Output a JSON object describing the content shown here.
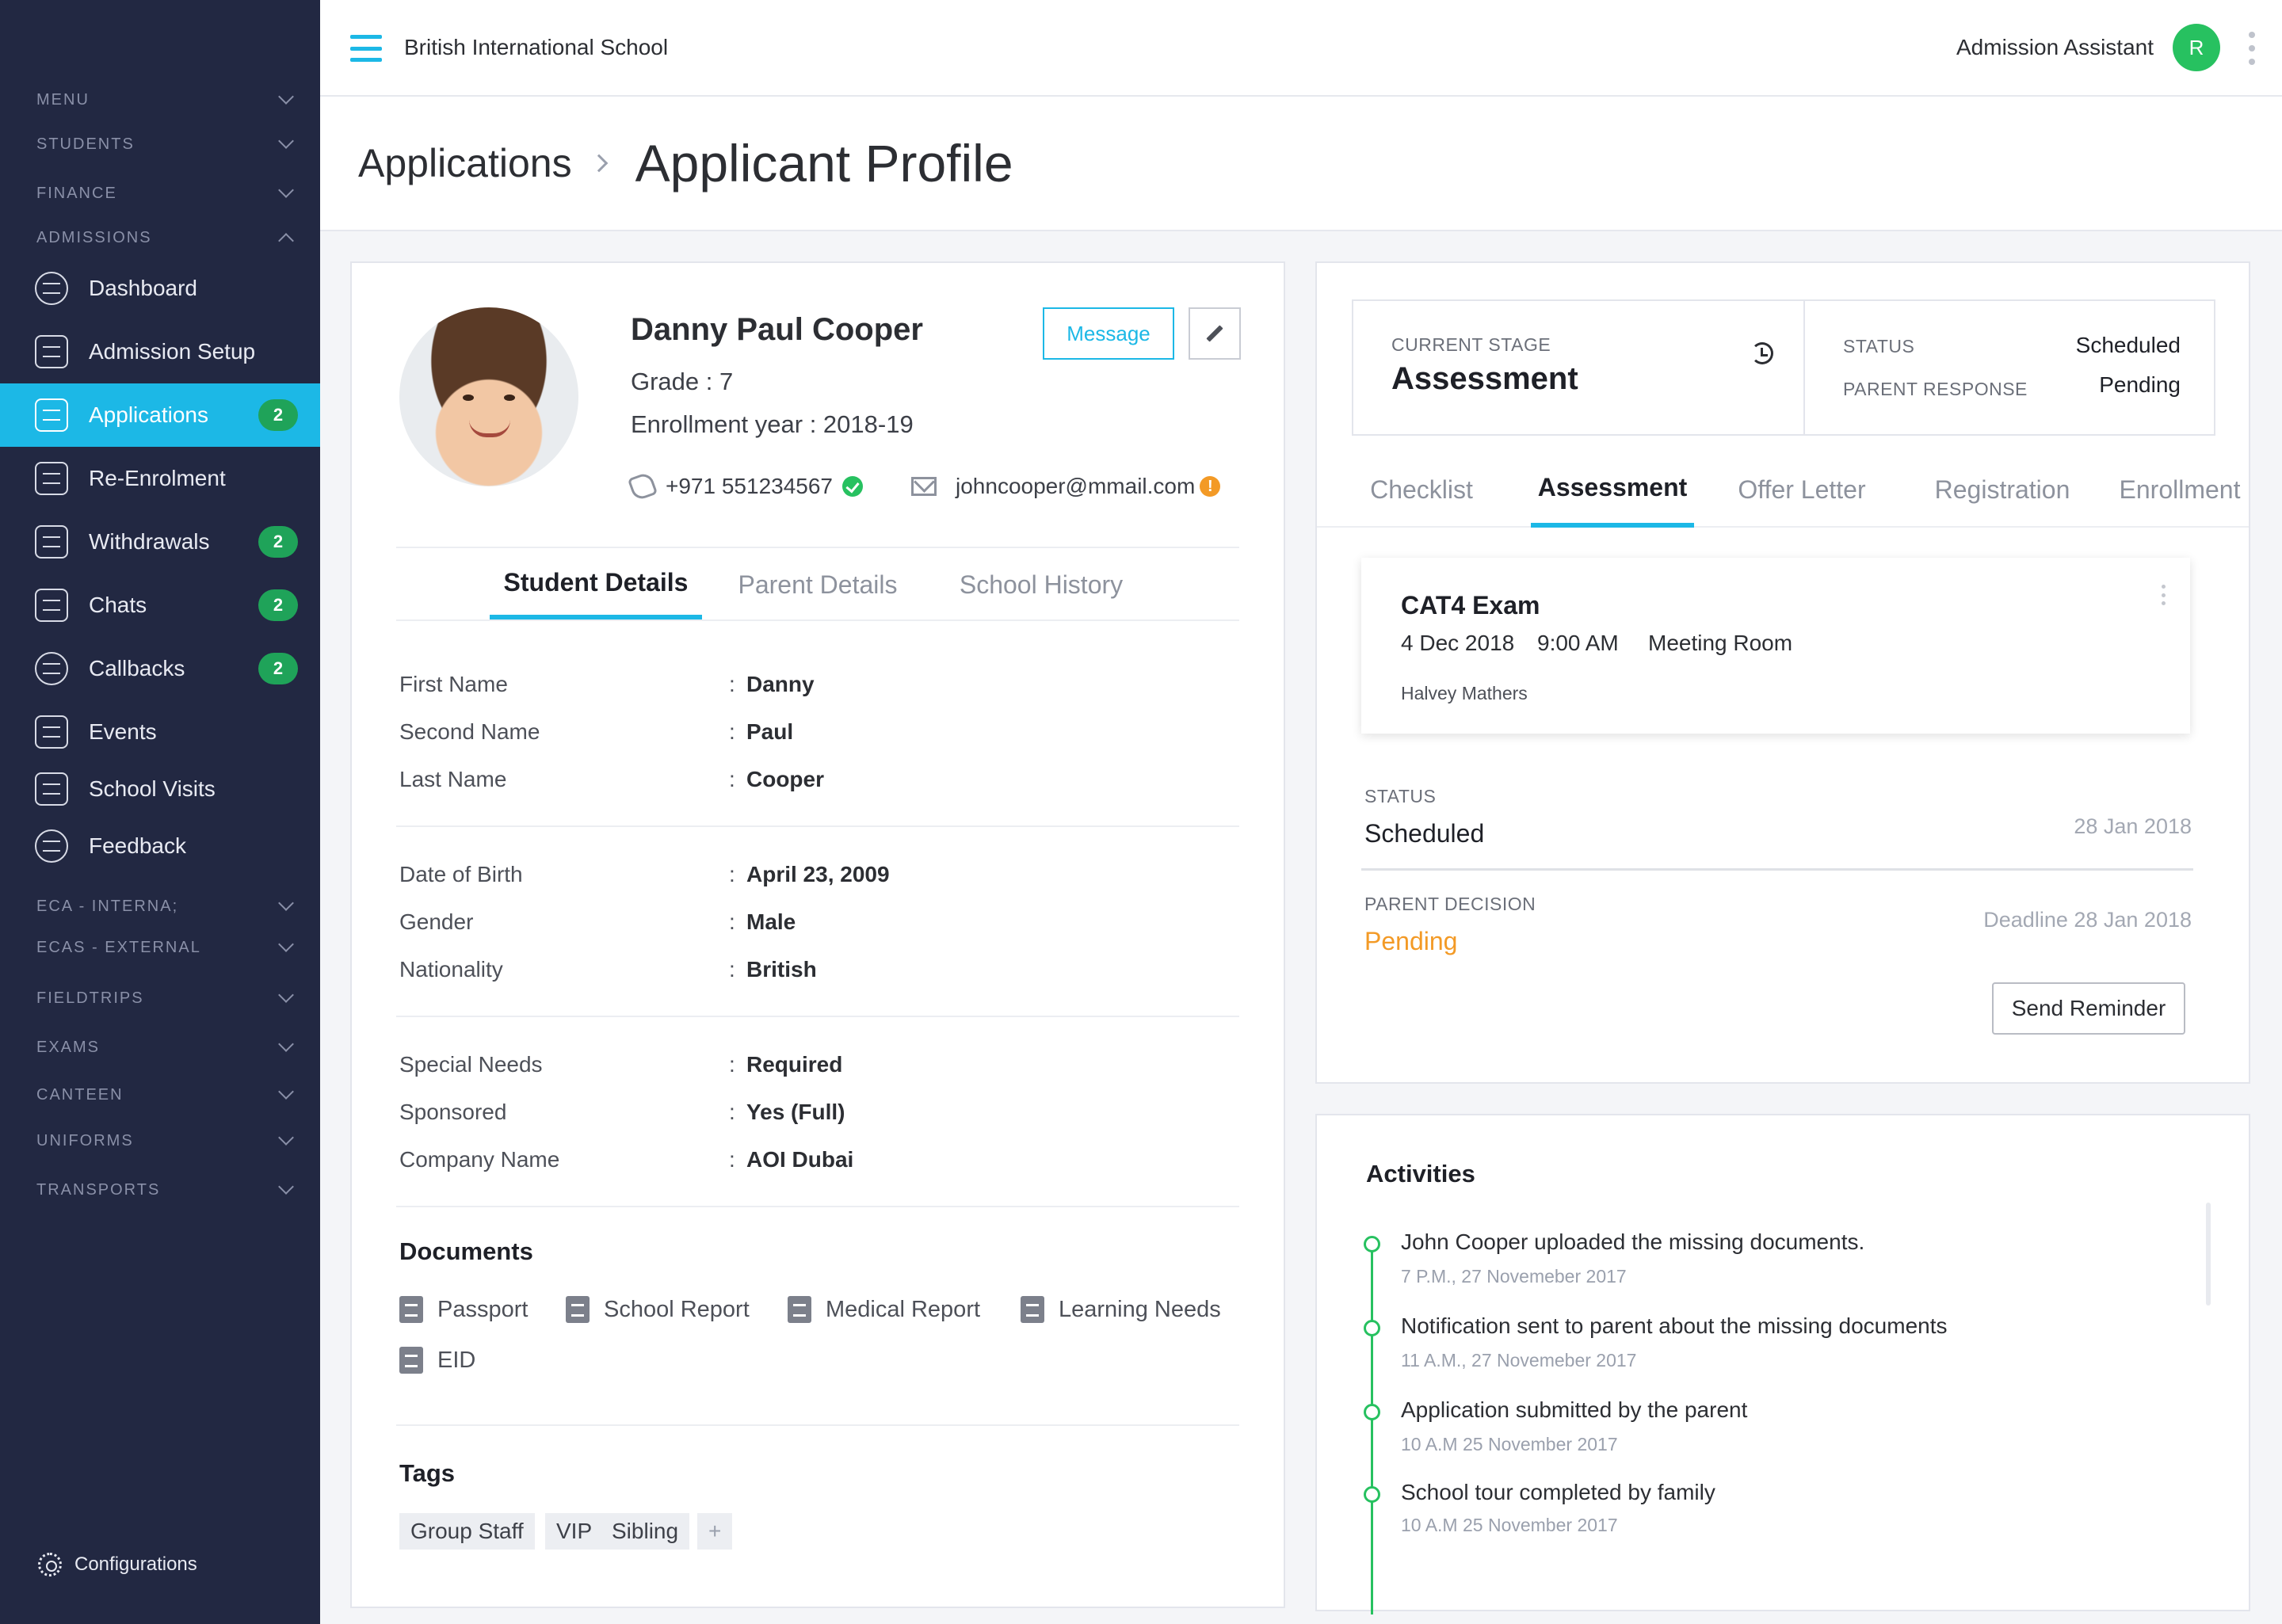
{
  "topbar": {
    "school_name": "British International School",
    "user_role": "Admission Assistant",
    "avatar_initial": "R"
  },
  "sidebar": {
    "sections": {
      "menu": "MENU",
      "students": "STUDENTS",
      "finance": "FINANCE",
      "admissions": "ADMISSIONS",
      "eca_internal": "ECA - INTERNA;",
      "ecas_external": "ECAS - EXTERNAL",
      "fieldtrips": "FIELDTRIPS",
      "exams": "EXAMS",
      "canteen": "CANTEEN",
      "uniforms": "UNIFORMS",
      "transports": "TRANSPORTS"
    },
    "items": [
      {
        "label": "Dashboard",
        "icon": "dashboard-icon"
      },
      {
        "label": "Admission Setup",
        "icon": "admission-setup-icon"
      },
      {
        "label": "Applications",
        "icon": "applications-icon",
        "badge": "2",
        "active": true
      },
      {
        "label": "Re-Enrolment",
        "icon": "re-enrolment-icon"
      },
      {
        "label": "Withdrawals",
        "icon": "withdrawals-icon",
        "badge": "2"
      },
      {
        "label": "Chats",
        "icon": "chats-icon",
        "badge": "2"
      },
      {
        "label": "Callbacks",
        "icon": "callbacks-icon",
        "badge": "2"
      },
      {
        "label": "Events",
        "icon": "events-icon"
      },
      {
        "label": "School Visits",
        "icon": "school-visits-icon"
      },
      {
        "label": "Feedback",
        "icon": "feedback-icon"
      }
    ],
    "configurations": "Configurations"
  },
  "header": {
    "breadcrumb": "Applications",
    "title": "Applicant Profile"
  },
  "profile": {
    "name": "Danny Paul Cooper",
    "grade": "Grade : 7",
    "enrollment_year": "Enrollment year : 2018-19",
    "phone": "+971 551234567",
    "email": "johncooper@mmail.com",
    "message_button": "Message",
    "tabs": [
      "Student Details",
      "Parent Details",
      "School History"
    ],
    "fields": [
      {
        "label": "First Name",
        "value": "Danny"
      },
      {
        "label": "Second Name",
        "value": "Paul"
      },
      {
        "label": "Last Name",
        "value": "Cooper"
      },
      {
        "label": "Date of Birth",
        "value": "April 23, 2009"
      },
      {
        "label": "Gender",
        "value": "Male"
      },
      {
        "label": "Nationality",
        "value": "British"
      },
      {
        "label": "Special Needs",
        "value": "Required"
      },
      {
        "label": "Sponsored",
        "value": "Yes (Full)"
      },
      {
        "label": "Company Name",
        "value": "AOI Dubai"
      }
    ],
    "colon": ":",
    "documents_title": "Documents",
    "documents": [
      "Passport",
      "School Report",
      "Medical Report",
      "Learning Needs",
      "EID"
    ],
    "tags_title": "Tags",
    "tags": [
      "Group Staff",
      "VIP",
      "Sibling"
    ],
    "add_tag": "+"
  },
  "stage": {
    "current_stage_label": "CURRENT STAGE",
    "current_stage": "Assessment",
    "status_label": "STATUS",
    "status": "Scheduled",
    "parent_response_label": "PARENT RESPONSE",
    "parent_response": "Pending",
    "tabs": [
      "Checklist",
      "Assessment",
      "Offer Letter",
      "Registration",
      "Enrollment"
    ],
    "exam": {
      "title": "CAT4 Exam",
      "date": "4 Dec 2018",
      "time": "9:00 AM",
      "room": "Meeting Room",
      "examiner": "Halvey Mathers"
    },
    "status_block_label": "STATUS",
    "status_block_value": "Scheduled",
    "status_date": "28 Jan 2018",
    "decision_label": "PARENT DECISION",
    "decision_value": "Pending",
    "deadline": "Deadline 28 Jan 2018",
    "reminder_button": "Send Reminder"
  },
  "activities": {
    "title": "Activities",
    "items": [
      {
        "text": "John Cooper uploaded the missing documents.",
        "time": "7 P.M., 27 Novemeber 2017"
      },
      {
        "text": "Notification sent to parent about the missing documents",
        "time": "11 A.M., 27 Novemeber 2017"
      },
      {
        "text": "Application submitted by the parent",
        "time": "10 A.M 25 November 2017"
      },
      {
        "text": "School tour completed by family",
        "time": "10 A.M 25 November 2017"
      }
    ]
  },
  "colors": {
    "sidebar_bg": "#222842",
    "accent": "#1cb8e6",
    "badge_green": "#1fa359",
    "pending_orange": "#f39a26"
  }
}
